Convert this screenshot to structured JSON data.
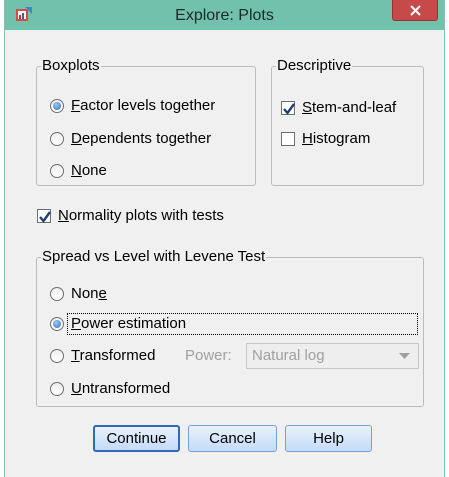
{
  "window": {
    "title": "Explore: Plots"
  },
  "boxplots": {
    "legend": "Boxplots",
    "options": [
      {
        "pre": "",
        "u": "F",
        "post": "actor levels together",
        "selected": true
      },
      {
        "pre": "",
        "u": "D",
        "post": "ependents together",
        "selected": false
      },
      {
        "pre": "",
        "u": "N",
        "post": "one",
        "selected": false
      }
    ]
  },
  "descriptive": {
    "legend": "Descriptive",
    "options": [
      {
        "pre": "",
        "u": "S",
        "post": "tem-and-leaf",
        "checked": true
      },
      {
        "pre": "",
        "u": "H",
        "post": "istogram",
        "checked": false
      }
    ]
  },
  "normality": {
    "pre": "",
    "u": "N",
    "post": "ormality plots with tests",
    "checked": true
  },
  "spread": {
    "legend": "Spread vs Level with Levene Test",
    "options": [
      {
        "pre": "Non",
        "u": "e",
        "post": "",
        "selected": false
      },
      {
        "pre": "",
        "u": "P",
        "post": "ower estimation",
        "selected": true
      },
      {
        "pre": "",
        "u": "T",
        "post": "ransformed",
        "selected": false
      },
      {
        "pre": "",
        "u": "U",
        "post": "ntransformed",
        "selected": false
      }
    ],
    "power_label": "Power:",
    "power_value": "Natural log"
  },
  "buttons": {
    "continue": "Continue",
    "cancel": "Cancel",
    "help": "Help"
  },
  "colors": {
    "titlebar": "#72c1ac",
    "close": "#c74a4b",
    "radio_dot": "#2a6fc4",
    "button_border": "#2f69b8"
  }
}
